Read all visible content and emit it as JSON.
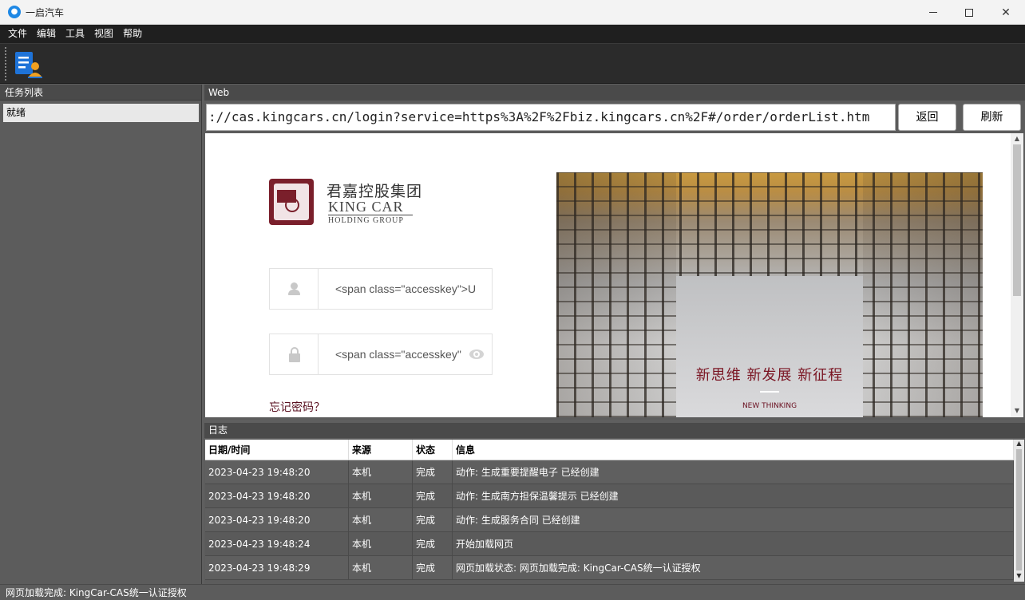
{
  "window": {
    "title": "一启汽车",
    "app_icon": "car-icon"
  },
  "menu": [
    "文件",
    "编辑",
    "工具",
    "视图",
    "帮助"
  ],
  "toolbar": {
    "button_icon": "task-document-user-icon"
  },
  "task_panel": {
    "header": "任务列表",
    "items": [
      "就绪"
    ]
  },
  "web_panel": {
    "header": "Web",
    "url": "://cas.kingcars.cn/login?service=https%3A%2F%2Fbiz.kingcars.cn%2F#/order/orderList.htm",
    "back_label": "返回",
    "refresh_label": "刷新"
  },
  "login_page": {
    "logo_cn": "君嘉控股集团",
    "logo_en_line1": "KING CAR",
    "logo_en_line2": "HOLDING GROUP",
    "username_placeholder": "<span class=\"accesskey\">U",
    "password_placeholder": "<span class=\"accesskey\"",
    "forgot_password": "忘记密码？",
    "slogan": "新思维 新发展 新征程",
    "slogan_en": "NEW THINKING",
    "brand_color": "#7a1422"
  },
  "log_panel": {
    "header": "日志",
    "columns": [
      "日期/时间",
      "来源",
      "状态",
      "信息"
    ],
    "rows": [
      [
        "2023-04-23 19:48:20",
        "本机",
        "完成",
        "动作: 生成重要提醒电子 已经创建"
      ],
      [
        "2023-04-23 19:48:20",
        "本机",
        "完成",
        "动作: 生成南方担保温馨提示 已经创建"
      ],
      [
        "2023-04-23 19:48:20",
        "本机",
        "完成",
        "动作: 生成服务合同 已经创建"
      ],
      [
        "2023-04-23 19:48:24",
        "本机",
        "完成",
        "开始加载网页"
      ],
      [
        "2023-04-23 19:48:29",
        "本机",
        "完成",
        "网页加载状态: 网页加载完成: KingCar-CAS统一认证授权"
      ]
    ]
  },
  "status_bar": {
    "text": "网页加载完成: KingCar-CAS统一认证授权"
  }
}
